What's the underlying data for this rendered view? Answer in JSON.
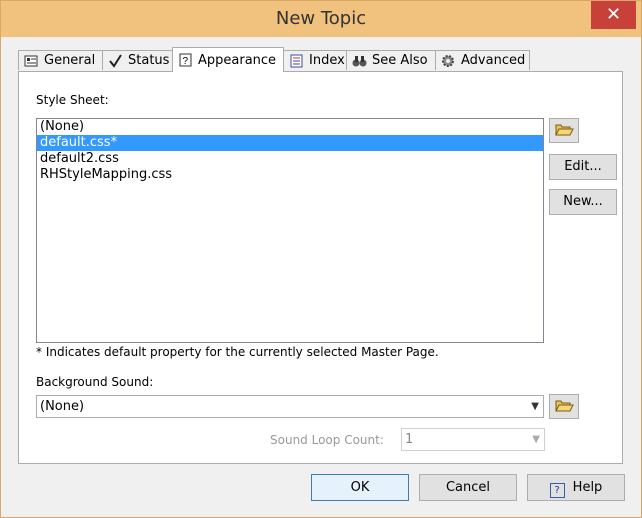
{
  "window": {
    "title": "New Topic",
    "close_glyph": "✕"
  },
  "tabs": [
    {
      "label": "General",
      "icon": "general-properties-icon"
    },
    {
      "label": "Status",
      "icon": "checkmark-icon"
    },
    {
      "label": "Appearance",
      "icon": "help-page-icon"
    },
    {
      "label": "Index",
      "icon": "index-icon"
    },
    {
      "label": "See Also",
      "icon": "binoculars-icon"
    },
    {
      "label": "Advanced",
      "icon": "gear-icon"
    }
  ],
  "appearance": {
    "style_sheet_label": "Style Sheet:",
    "style_sheets": [
      "(None)",
      "default.css*",
      "default2.css",
      "RHStyleMapping.css"
    ],
    "selected_index": 1,
    "edit_button": "Edit...",
    "new_button": "New...",
    "note": "* Indicates default property for the currently selected Master Page.",
    "background_sound_label": "Background Sound:",
    "background_sound_value": "(None)",
    "sound_loop_label": "Sound Loop Count:",
    "sound_loop_value": "1"
  },
  "footer": {
    "ok": "OK",
    "cancel": "Cancel",
    "help": "Help",
    "help_icon": "?"
  },
  "colors": {
    "titlebar": "#f0c27e",
    "selection": "#3399ff",
    "close": "#c7403a"
  }
}
